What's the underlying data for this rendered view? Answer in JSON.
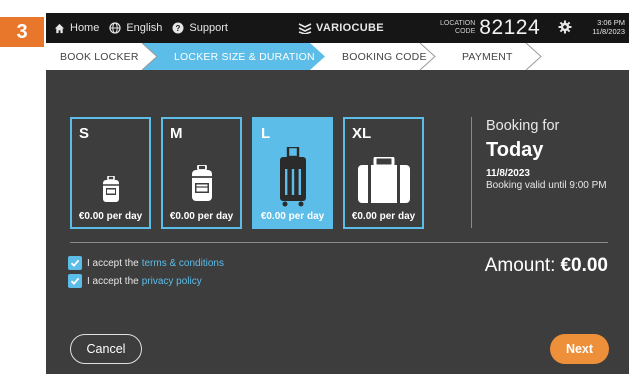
{
  "step_number": "3",
  "topbar": {
    "home_label": "Home",
    "language_label": "English",
    "support_label": "Support",
    "brand": "VARIOCUBE",
    "location_label_line1": "LOCATION",
    "location_label_line2": "CODE",
    "location_code": "82124",
    "time": "3:06 PM",
    "date": "11/8/2023",
    "icons": [
      "home-icon",
      "globe-icon",
      "help-icon",
      "variocube-logo-icon",
      "gear-icon"
    ]
  },
  "steps": [
    {
      "label": "BOOK LOCKER",
      "active": false
    },
    {
      "label": "LOCKER SIZE & DURATION",
      "active": true
    },
    {
      "label": "BOOKING CODE",
      "active": false
    },
    {
      "label": "PAYMENT",
      "active": false
    }
  ],
  "sizes": [
    {
      "letter": "S",
      "price": "€0.00 per day",
      "icon": "backpack-small-icon",
      "selected": false
    },
    {
      "letter": "M",
      "price": "€0.00 per day",
      "icon": "backpack-medium-icon",
      "selected": false
    },
    {
      "letter": "L",
      "price": "€0.00 per day",
      "icon": "suitcase-icon",
      "selected": true
    },
    {
      "letter": "XL",
      "price": "€0.00 per day",
      "icon": "briefcase-icon",
      "selected": false
    }
  ],
  "booking": {
    "for_label": "Booking for",
    "day": "Today",
    "date": "11/8/2023",
    "valid_text": "Booking valid until 9:00 PM"
  },
  "terms": {
    "prefix": "I accept the",
    "link": "terms & conditions",
    "checked": true
  },
  "privacy": {
    "prefix": "I accept the",
    "link": "privacy policy",
    "checked": true
  },
  "amount": {
    "label": "Amount:",
    "value": "€0.00"
  },
  "buttons": {
    "cancel": "Cancel",
    "next": "Next"
  },
  "colors": {
    "accent_blue": "#5bbde8",
    "accent_orange": "#ee8f3a",
    "badge_orange": "#e8762b",
    "background": "#3d3d3d",
    "topbar": "#161616"
  }
}
